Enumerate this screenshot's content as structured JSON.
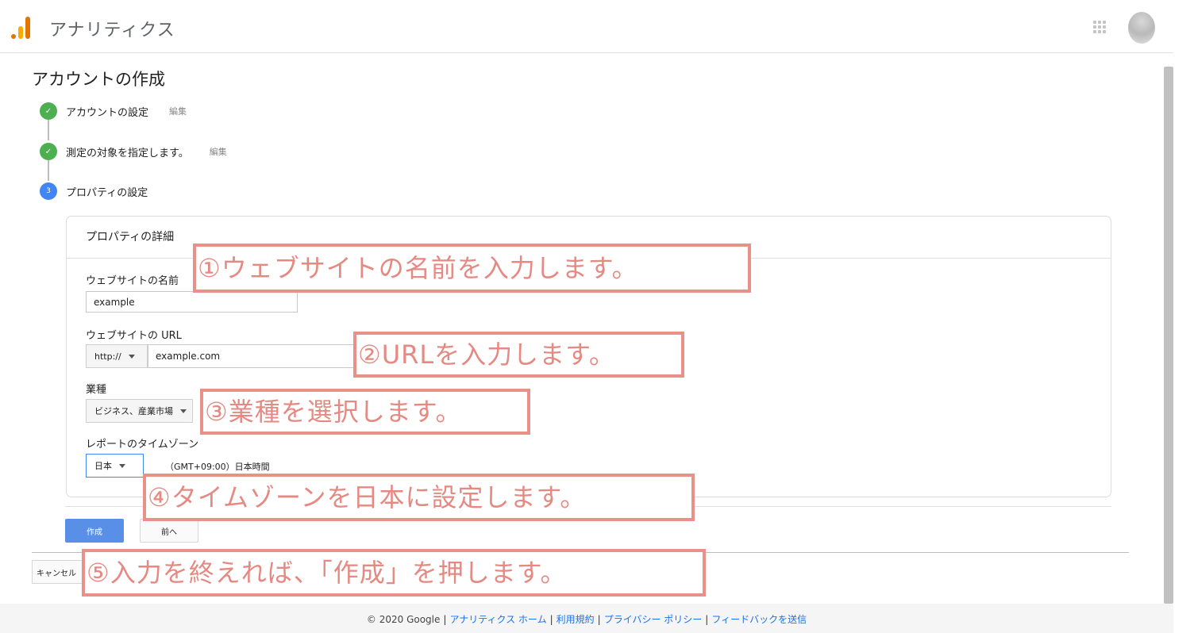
{
  "header": {
    "app_title": "アナリティクス"
  },
  "page": {
    "title": "アカウントの作成"
  },
  "steps": [
    {
      "label": "アカウントの設定",
      "edit": "編集",
      "state": "done"
    },
    {
      "label": "測定の対象を指定します。",
      "edit": "編集",
      "state": "done"
    },
    {
      "label": "プロパティの設定",
      "number": "3",
      "state": "current"
    }
  ],
  "card": {
    "title": "プロパティの詳細",
    "website_name": {
      "label": "ウェブサイトの名前",
      "value": "example"
    },
    "website_url": {
      "label": "ウェブサイトの URL",
      "protocol": "http://",
      "value": "example.com"
    },
    "industry": {
      "label": "業種",
      "value": "ビジネス、産業市場"
    },
    "timezone": {
      "label": "レポートのタイムゾーン",
      "country": "日本",
      "zone": "（GMT+09:00）日本時間"
    }
  },
  "actions": {
    "create": "作成",
    "back": "前へ",
    "cancel": "キャンセル"
  },
  "annotations": [
    "①ウェブサイトの名前を入力します。",
    "②URLを入力します。",
    "③業種を選択します。",
    "④タイムゾーンを日本に設定します。",
    "⑤入力を終えれば、「作成」を押します。"
  ],
  "footer": {
    "copyright": "© 2020 Google",
    "links": [
      "アナリティクス ホーム",
      "利用規約",
      "プライバシー ポリシー",
      "フィードバックを送信"
    ]
  },
  "colors": {
    "accent": "#4285f4",
    "done": "#4caf50",
    "annotation": "#e99188",
    "primary_button": "#5a8fe8"
  },
  "icons": [
    "analytics-logo-icon",
    "apps-grid-icon",
    "check-icon",
    "caret-down-icon"
  ]
}
